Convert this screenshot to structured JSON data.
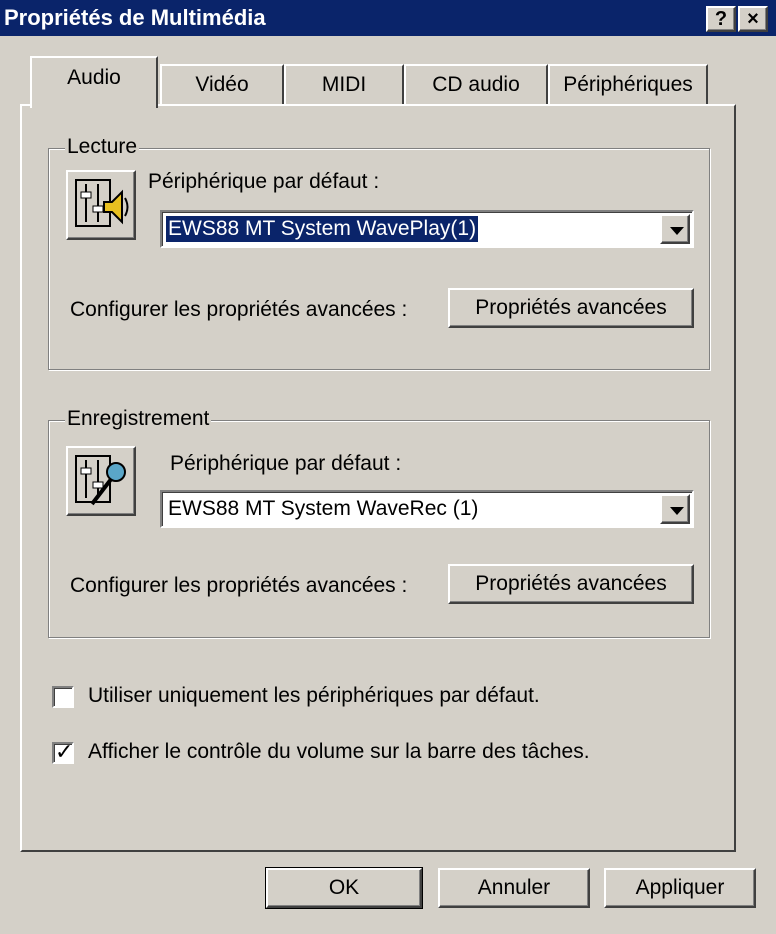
{
  "window": {
    "title": "Propriétés de Multimédia",
    "help_button": "?",
    "close_button": "×",
    "colors": {
      "titlebar": "#0a246a",
      "face": "#d4d0c8",
      "selection": "#0a246a"
    }
  },
  "tabs": [
    {
      "label": "Audio",
      "active": true
    },
    {
      "label": "Vidéo",
      "active": false
    },
    {
      "label": "MIDI",
      "active": false
    },
    {
      "label": "CD audio",
      "active": false
    },
    {
      "label": "Périphériques",
      "active": false
    }
  ],
  "playback": {
    "group_title": "Lecture",
    "icon": "speaker-mixer-icon",
    "device_label": "Périphérique par défaut :",
    "device_value": "EWS88 MT System WavePlay(1)",
    "advanced_label": "Configurer les propriétés avancées :",
    "advanced_button": "Propriétés avancées"
  },
  "recording": {
    "group_title": "Enregistrement",
    "icon": "microphone-mixer-icon",
    "device_label": "Périphérique par défaut :",
    "device_value": "EWS88 MT System WaveRec (1)",
    "advanced_label": "Configurer les propriétés avancées :",
    "advanced_button": "Propriétés avancées"
  },
  "options": {
    "default_only": {
      "label": "Utiliser uniquement les périphériques par défaut.",
      "checked": false
    },
    "show_volume": {
      "label": "Afficher le contrôle du volume sur la barre des tâches.",
      "checked": true,
      "mark": "✓"
    }
  },
  "buttons": {
    "ok": "OK",
    "cancel": "Annuler",
    "apply": "Appliquer"
  }
}
